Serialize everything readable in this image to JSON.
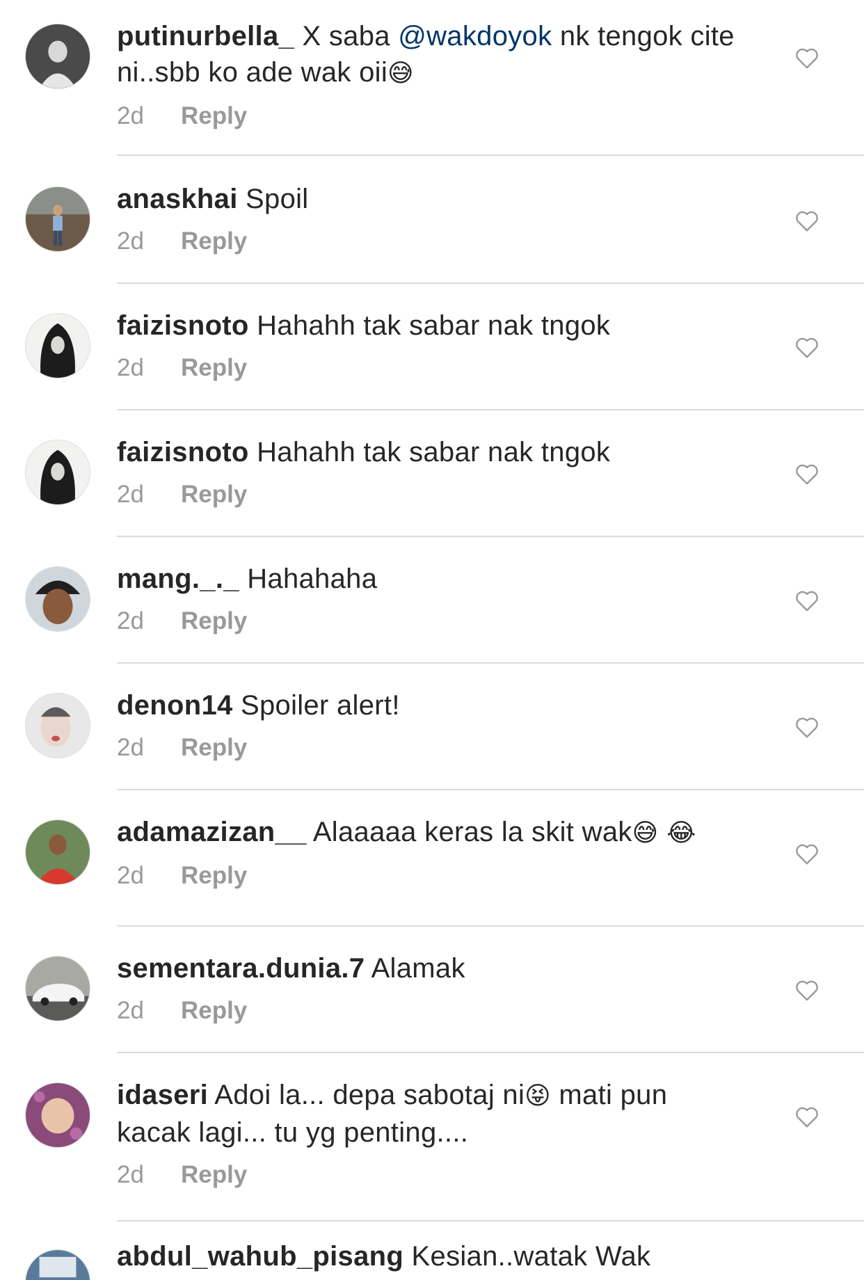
{
  "comments": [
    {
      "username": "putinurbella_",
      "pre": " X saba ",
      "mention": "@wakdoyok",
      "post": " nk tengok cite ni..sbb ko ade wak oii",
      "emoji": "😅",
      "time": "2d",
      "reply": "Reply"
    },
    {
      "username": "anaskhai",
      "pre": " Spoil",
      "time": "2d",
      "reply": "Reply"
    },
    {
      "username": "faizisnoto",
      "pre": " Hahahh tak sabar nak tngok",
      "time": "2d",
      "reply": "Reply"
    },
    {
      "username": "faizisnoto",
      "pre": " Hahahh tak sabar nak tngok",
      "time": "2d",
      "reply": "Reply"
    },
    {
      "username": "mang._._",
      "pre": " Hahahaha",
      "time": "2d",
      "reply": "Reply"
    },
    {
      "username": "denon14",
      "pre": " Spoiler alert!",
      "time": "2d",
      "reply": "Reply"
    },
    {
      "username": "adamazizan__",
      "pre": " Alaaaaa keras la skit wak",
      "emoji": "😅 😂",
      "time": "2d",
      "reply": "Reply"
    },
    {
      "username": "sementara.dunia.7",
      "pre": " Alamak",
      "time": "2d",
      "reply": "Reply"
    },
    {
      "username": "idaseri",
      "pre": " Adoi la... depa sabotaj ni",
      "emoji": "😝",
      "post": "  mati pun kacak lagi... tu yg penting....",
      "time": "2d",
      "reply": "Reply"
    },
    {
      "username": "abdul_wahub_pisang",
      "pre": " Kesian..watak Wak"
    }
  ],
  "colors": {
    "mention": "#003569",
    "meta": "#999999",
    "divider": "#dbdbdb",
    "text": "#262626"
  },
  "icons": {
    "like": "heart-outline-icon"
  }
}
